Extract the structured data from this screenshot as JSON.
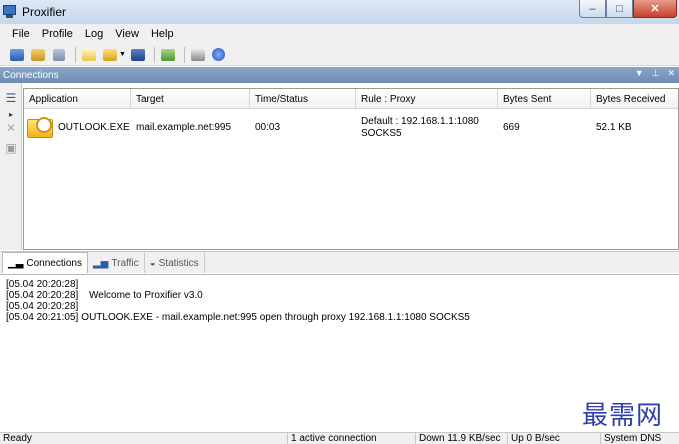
{
  "window": {
    "title": "Proxifier",
    "minimize": "–",
    "maximize": "□",
    "close": "✕"
  },
  "menu": [
    "File",
    "Profile",
    "Log",
    "View",
    "Help"
  ],
  "toolbar_icons": [
    "proxy-servers-icon",
    "proxification-rules-icon",
    "name-resolution-icon",
    "new-profile-icon",
    "open-profile-icon",
    "save-profile-icon",
    "import-icon",
    "print-icon",
    "help-icon"
  ],
  "panel": {
    "title": "Connections"
  },
  "table": {
    "columns": [
      "Application",
      "Target",
      "Time/Status",
      "Rule : Proxy",
      "Bytes Sent",
      "Bytes Received"
    ],
    "rows": [
      {
        "application": "OUTLOOK.EXE",
        "target": "mail.example.net:995",
        "time_status": "00:03",
        "rule_line1": "Default : 192.168.1.1:1080",
        "rule_line2": "SOCKS5",
        "bytes_sent": "669",
        "bytes_received": "52.1 KB"
      }
    ]
  },
  "tabs": [
    "Connections",
    "Traffic",
    "Statistics"
  ],
  "log": [
    {
      "ts": "[05.04 20:20:28]",
      "msg": ""
    },
    {
      "ts": "[05.04 20:20:28]",
      "msg": "Welcome to Proxifier v3.0"
    },
    {
      "ts": "[05.04 20:20:28]",
      "msg": ""
    },
    {
      "ts": "[05.04 20:21:05]",
      "msg": "OUTLOOK.EXE - mail.example.net:995 open through proxy 192.168.1.1:1080 SOCKS5"
    }
  ],
  "watermark": "最需网",
  "status": {
    "ready": "Ready",
    "connections": "1 active connection",
    "down": "Down 11.9 KB/sec",
    "up": "Up 0 B/sec",
    "dns": "System DNS"
  }
}
